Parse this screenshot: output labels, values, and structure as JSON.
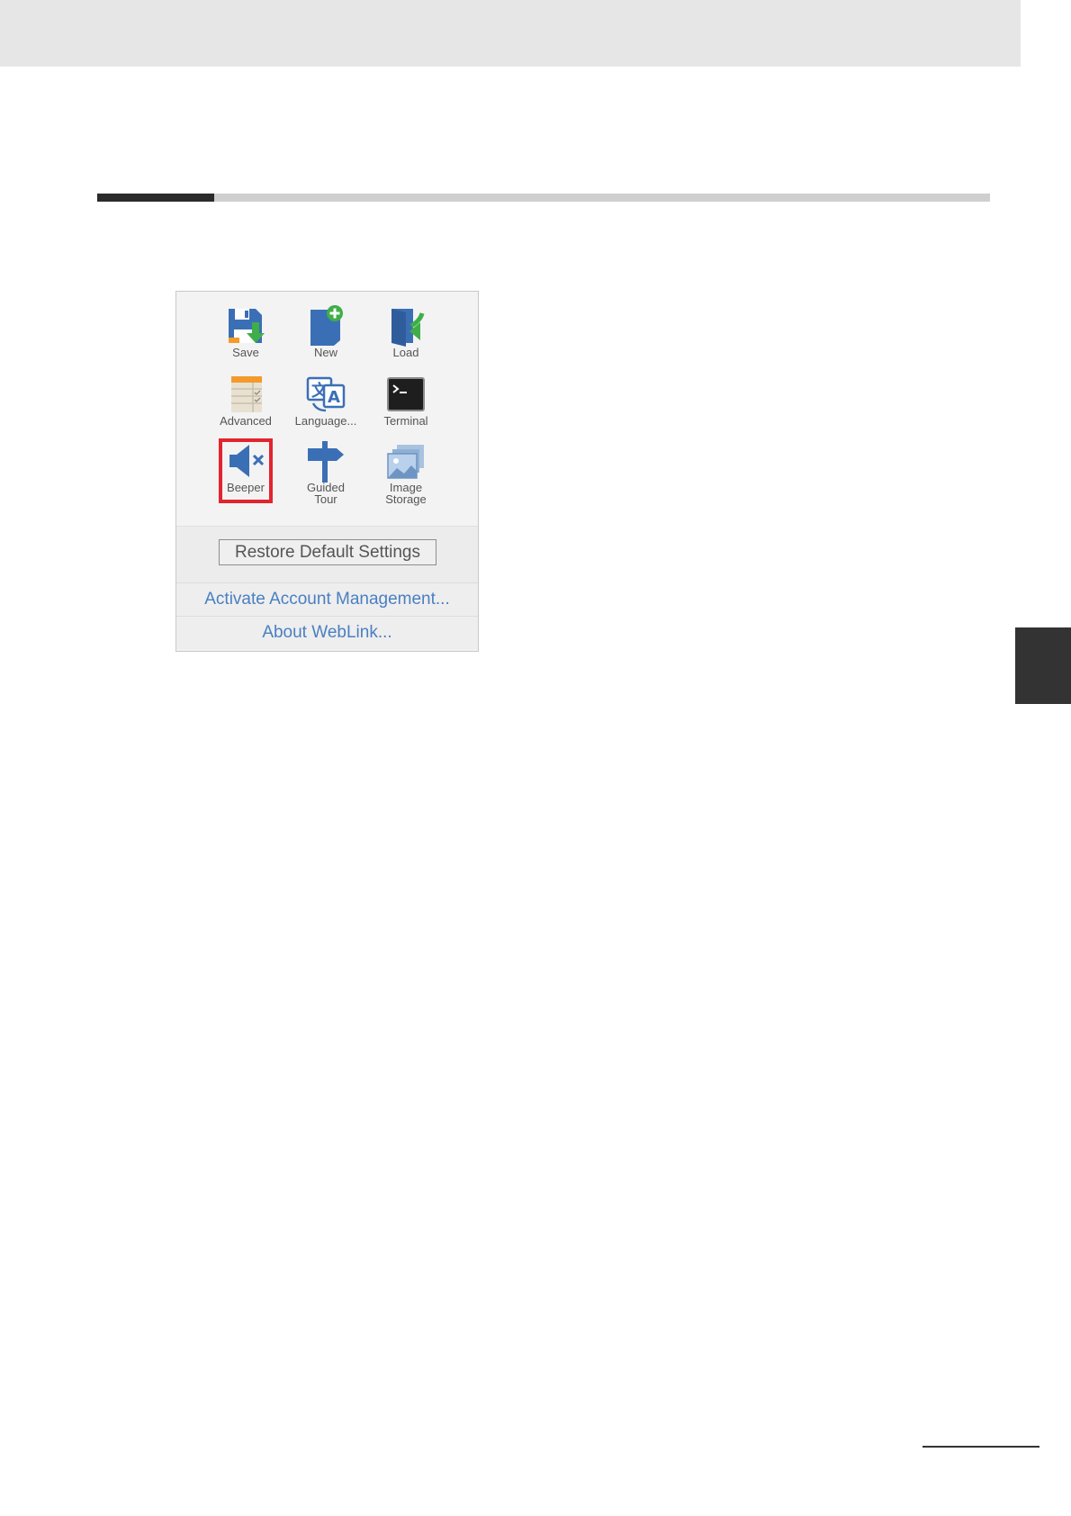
{
  "menu": {
    "tiles": [
      {
        "label": "Save",
        "icon": "save-icon"
      },
      {
        "label": "New",
        "icon": "new-icon"
      },
      {
        "label": "Load",
        "icon": "load-icon"
      },
      {
        "label": "Advanced",
        "icon": "advanced-icon"
      },
      {
        "label": "Language...",
        "icon": "language-icon"
      },
      {
        "label": "Terminal",
        "icon": "terminal-icon"
      },
      {
        "label": "Beeper",
        "icon": "speaker-muted-icon"
      },
      {
        "label_line1": "Guided",
        "label_line2": "Tour",
        "icon": "signpost-icon"
      },
      {
        "label_line1": "Image",
        "label_line2": "Storage",
        "icon": "image-stack-icon"
      }
    ],
    "restore_label": "Restore Default Settings",
    "account_link": "Activate Account Management...",
    "about_link": "About WebLink..."
  },
  "colors": {
    "highlight": "#e2242f",
    "link": "#4a7fc1",
    "icon_blue": "#3b6fb5",
    "icon_green": "#3fae49"
  }
}
